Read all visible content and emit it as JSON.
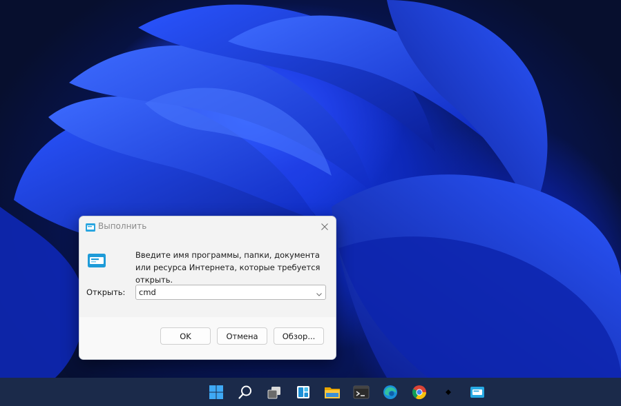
{
  "dialog": {
    "title": "Выполнить",
    "description": "Введите имя программы, папки, документа или ресурса Интернета, которые требуется открыть.",
    "open_label": "Открыть:",
    "command_value": "cmd",
    "buttons": {
      "ok": "OK",
      "cancel": "Отмена",
      "browse": "Обзор..."
    },
    "icons": {
      "title": "run-icon",
      "big": "run-icon",
      "close": "close-icon",
      "dropdown": "chevron-down-icon"
    }
  },
  "taskbar": {
    "items": [
      {
        "name": "start",
        "icon": "windows-logo-icon"
      },
      {
        "name": "search",
        "icon": "search-icon"
      },
      {
        "name": "task-view",
        "icon": "task-view-icon"
      },
      {
        "name": "widgets",
        "icon": "widgets-icon"
      },
      {
        "name": "file-explorer",
        "icon": "folder-icon"
      },
      {
        "name": "terminal",
        "icon": "terminal-icon"
      },
      {
        "name": "edge",
        "icon": "edge-icon"
      },
      {
        "name": "chrome",
        "icon": "chrome-icon"
      },
      {
        "name": "unknown-app",
        "icon": "small-app-icon"
      },
      {
        "name": "run",
        "icon": "run-icon"
      }
    ]
  },
  "colors": {
    "taskbar": "#1b2a4a",
    "wallpaper_blue": "#1f3fe6",
    "dialog_bg": "#f3f3f3"
  }
}
